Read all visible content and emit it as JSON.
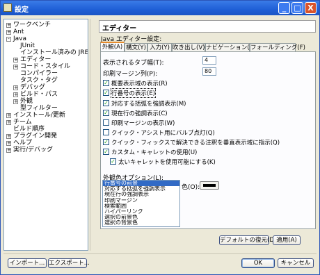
{
  "window": {
    "title": "設定"
  },
  "title_buttons": {
    "minimize": "_",
    "maximize": "□",
    "close": "X"
  },
  "tree": [
    {
      "label": "ワークベンチ",
      "indent": 0,
      "exp": "+"
    },
    {
      "label": "Ant",
      "indent": 0,
      "exp": "+"
    },
    {
      "label": "Java",
      "indent": 0,
      "exp": "−"
    },
    {
      "label": "JUnit",
      "indent": 1,
      "exp": ""
    },
    {
      "label": "インストール済みの JRE",
      "indent": 1,
      "exp": ""
    },
    {
      "label": "エディター",
      "indent": 1,
      "exp": "+"
    },
    {
      "label": "コード・スタイル",
      "indent": 1,
      "exp": "+"
    },
    {
      "label": "コンパイラー",
      "indent": 1,
      "exp": ""
    },
    {
      "label": "タスク・タグ",
      "indent": 1,
      "exp": ""
    },
    {
      "label": "デバッグ",
      "indent": 1,
      "exp": "+"
    },
    {
      "label": "ビルド・パス",
      "indent": 1,
      "exp": "+"
    },
    {
      "label": "外観",
      "indent": 1,
      "exp": "+"
    },
    {
      "label": "型フィルター",
      "indent": 1,
      "exp": ""
    },
    {
      "label": "インストール/更新",
      "indent": 0,
      "exp": "+"
    },
    {
      "label": "チーム",
      "indent": 0,
      "exp": "+"
    },
    {
      "label": "ビルド順序",
      "indent": 0,
      "exp": ""
    },
    {
      "label": "プラグイン開発",
      "indent": 0,
      "exp": "+"
    },
    {
      "label": "ヘルプ",
      "indent": 0,
      "exp": "+"
    },
    {
      "label": "実行/デバッグ",
      "indent": 0,
      "exp": "+"
    }
  ],
  "page": {
    "title": "エディター",
    "description": "Java エディター設定:",
    "tabs": [
      "外観(A)",
      "構文(Y)",
      "入力(Y)",
      "吹き出し(V)",
      "ナビゲーション(G)",
      "フォールディング(F)"
    ],
    "tab_width_label": "表示されるタブ幅(T):",
    "tab_width_value": "4",
    "margin_label": "印刷マージン列(P):",
    "margin_value": "80",
    "options": [
      {
        "label": "概要表示域の表示(R)",
        "checked": true
      },
      {
        "label": "行番号の表示(E)",
        "checked": true
      },
      {
        "label": "対応する括弧を強調表示(M)",
        "checked": true
      },
      {
        "label": "現在行の強調表示(C)",
        "checked": true
      },
      {
        "label": "印刷マージンの表示(W)",
        "checked": false
      },
      {
        "label": "クイック・アシスト用にバルブ点灯(Q)",
        "checked": false
      },
      {
        "label": "クイック・フィックスで解決できる注釈を垂直表示域に指示(Q)",
        "checked": true
      },
      {
        "label": "カスタム・キャレットの使用(U)",
        "checked": true
      },
      {
        "label": "太いキャレットを使用可能にする(K)",
        "checked": true
      }
    ],
    "color_options_label": "外観色オプション(L):",
    "color_list": [
      "行番号の前景",
      "対応する括弧を強調表示",
      "現在行の強調表示",
      "印刷マージン",
      "検索範囲",
      "ハイパーリンク",
      "選択の前景色",
      "選択の背景色"
    ],
    "selected_color_index": 0,
    "color_label": "色(O):",
    "swatch_color": "#000000"
  },
  "buttons": {
    "restore_defaults": "デフォルトの復元(D)",
    "apply": "適用(A)",
    "import": "インポート...",
    "export": "エクスポート...",
    "ok": "OK",
    "cancel": "キャンセル"
  }
}
